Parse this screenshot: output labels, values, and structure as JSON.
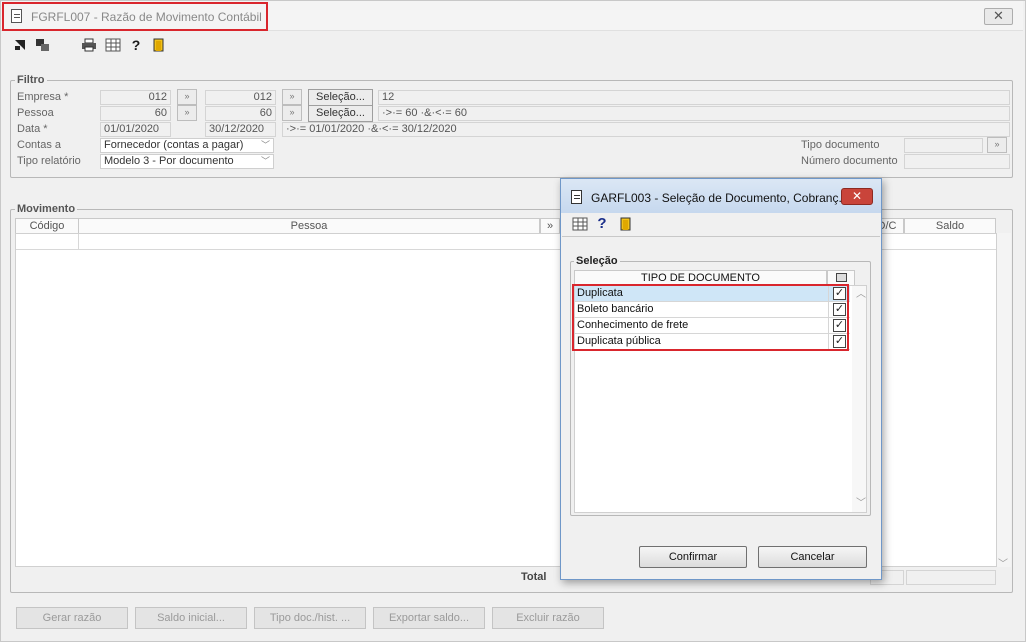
{
  "window": {
    "title": "FGRFL007 - Razão de Movimento Contábil",
    "close_glyph": "✕"
  },
  "toolbar": {
    "icons": [
      "arrow-in-icon",
      "copy-icon",
      "print-icon",
      "grid-icon",
      "help-icon",
      "exit-door-icon"
    ]
  },
  "filtro": {
    "legend": "Filtro",
    "empresa_label": "Empresa *",
    "empresa_from": "012",
    "empresa_to": "012",
    "empresa_selection": "12",
    "pessoa_label": "Pessoa",
    "pessoa_from": "60",
    "pessoa_to": "60",
    "pessoa_selection": "·>·= 60 ·&·<·= 60",
    "data_label": "Data *",
    "data_from": "01/01/2020",
    "data_to": "30/12/2020",
    "data_selection": "·>·= 01/01/2020 ·&·<·= 30/12/2020",
    "selecao_button": "Seleção...",
    "contas_label": "Contas a",
    "contas_value": "Fornecedor (contas a pagar)",
    "tipo_relatorio_label": "Tipo relatório",
    "tipo_relatorio_value": "Modelo 3 - Por documento",
    "tipo_documento_label": "Tipo documento",
    "numero_documento_label": "Número documento",
    "mini_btn_glyph": "»"
  },
  "movimento": {
    "legend": "Movimento",
    "col_codigo": "Código",
    "col_pessoa": "Pessoa",
    "col_dc": "D/C",
    "col_saldo": "Saldo",
    "total_label": "Total"
  },
  "bottom_buttons": [
    {
      "label": "Gerar razão"
    },
    {
      "label": "Saldo inicial..."
    },
    {
      "label": "Tipo doc./hist. ..."
    },
    {
      "label": "Exportar saldo..."
    },
    {
      "label": "Excluir razão"
    }
  ],
  "dialog": {
    "title": "GARFL003 - Seleção de Documento, Cobranç...",
    "close_glyph": "✕",
    "group_legend": "Seleção",
    "column_header": "TIPO DE DOCUMENTO",
    "items": [
      {
        "label": "Duplicata",
        "checked": "✓"
      },
      {
        "label": "Boleto bancário",
        "checked": "✓"
      },
      {
        "label": "Conhecimento de frete",
        "checked": "✓"
      },
      {
        "label": "Duplicata pública",
        "checked": "✓"
      }
    ],
    "confirm_button": "Confirmar",
    "cancel_button": "Cancelar",
    "scroll_up": "︿",
    "scroll_down": "﹀"
  },
  "colors": {
    "highlight": "#d9262d",
    "selected_row": "#cfe6f7"
  }
}
